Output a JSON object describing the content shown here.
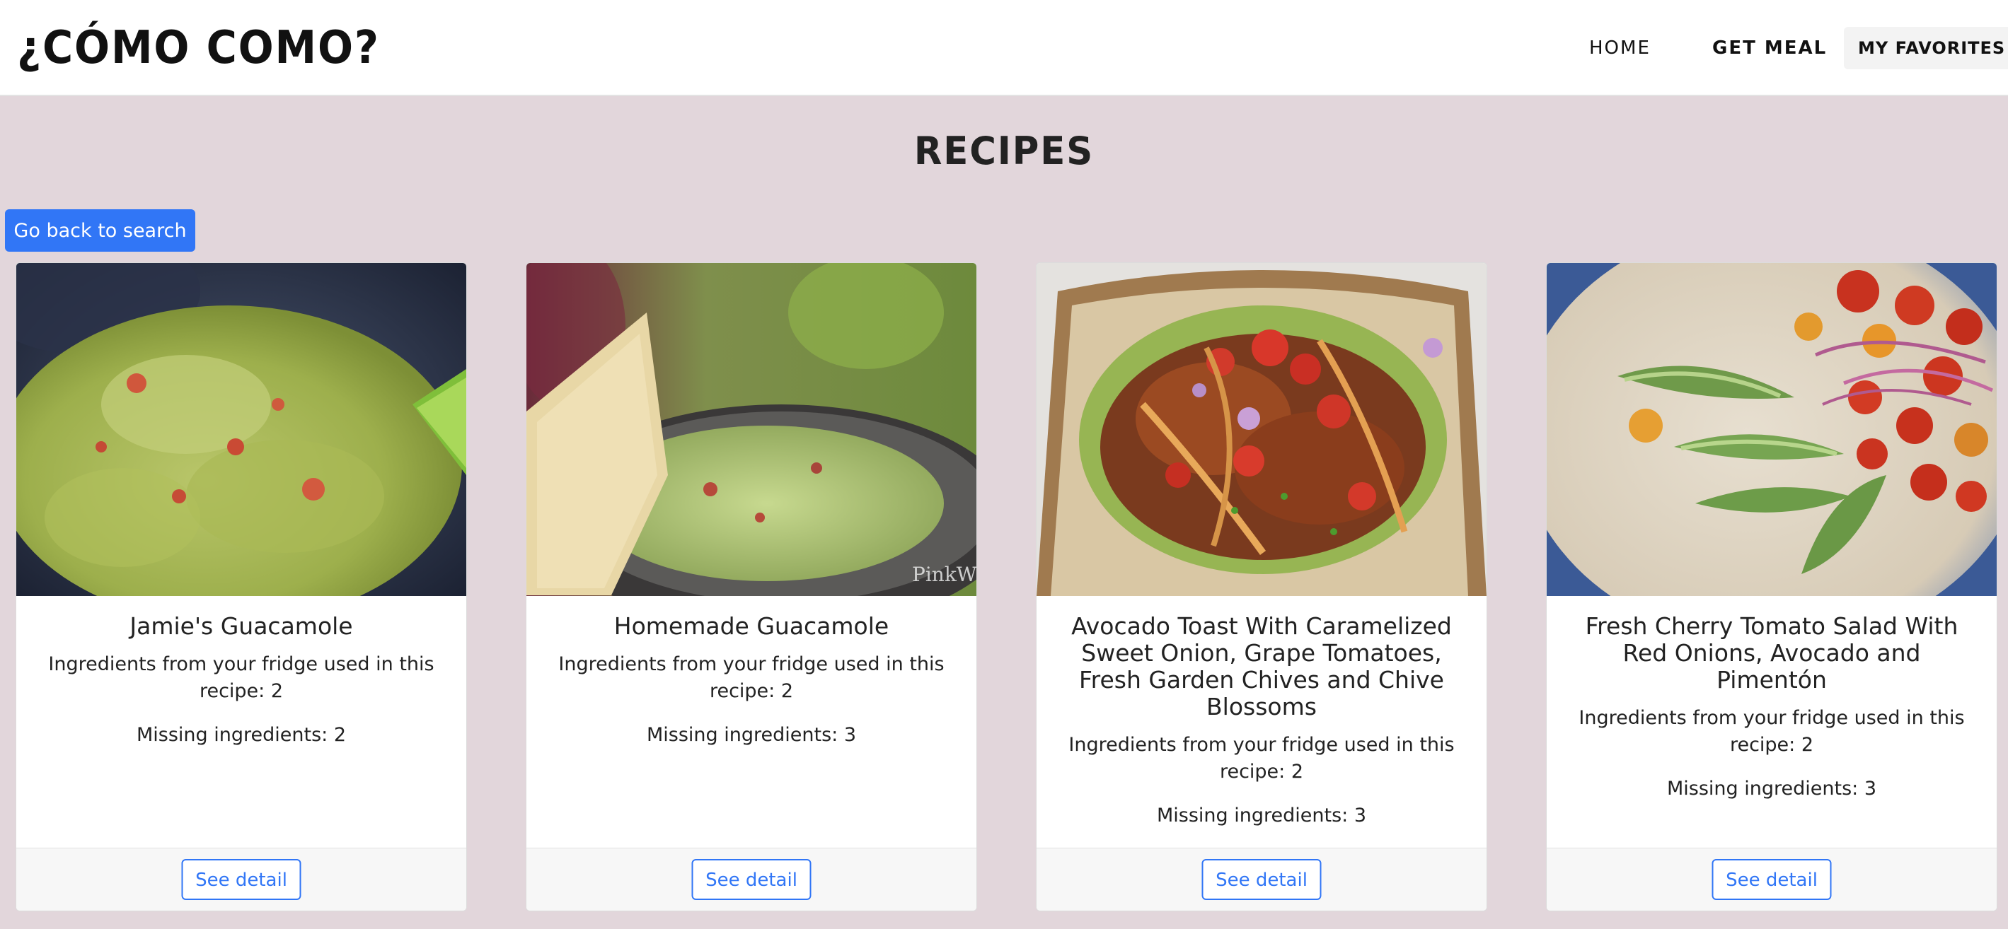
{
  "navbar": {
    "brand": "¿Cómo como?",
    "links": {
      "home": "Home",
      "get_meal": "Get Meal",
      "favorites": "My Favorites"
    },
    "favorites_icon": "yellow-heart-icon"
  },
  "page": {
    "title": "Recipes",
    "back_button": "Go back to search"
  },
  "recipes": [
    {
      "title": "Jamie's Guacamole",
      "used": "Ingredients from your fridge used in this recipe: 2",
      "missing": "Missing ingredients: 2",
      "button": "See detail"
    },
    {
      "title": "Homemade Guacamole",
      "used": "Ingredients from your fridge used in this recipe: 2",
      "missing": "Missing ingredients: 3",
      "button": "See detail"
    },
    {
      "title": "Avocado Toast With Caramelized Sweet Onion, Grape Tomatoes, Fresh Garden Chives and Chive Blossoms",
      "used": "Ingredients from your fridge used in this recipe: 2",
      "missing": "Missing ingredients: 3",
      "button": "See detail"
    },
    {
      "title": "Fresh Cherry Tomato Salad With Red Onions, Avocado and Pimentón",
      "used": "Ingredients from your fridge used in this recipe: 2",
      "missing": "Missing ingredients: 3",
      "button": "See detail"
    }
  ],
  "colors": {
    "page_background": "#e2d6db",
    "primary": "#3176f6",
    "heart": "#f2c94c"
  }
}
